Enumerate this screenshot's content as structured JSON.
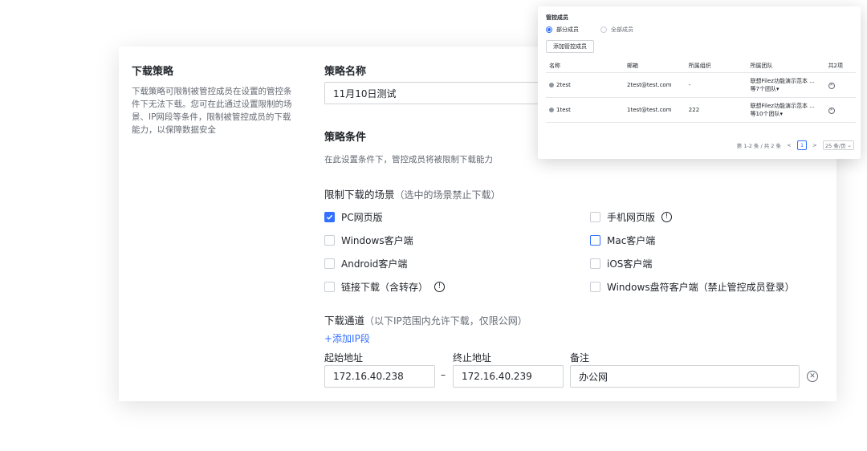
{
  "left": {
    "title": "下载策略",
    "desc": "下载策略可限制被管控成员在设置的管控条件下无法下载。您可在此通过设置限制的场景、IP网段等条件，限制被管控成员的下载能力，以保障数据安全"
  },
  "form": {
    "name_label": "策略名称",
    "name_value": "11月10日测试",
    "cond_label": "策略条件",
    "cond_hint": "在此设置条件下，管控成员将被限制下载能力",
    "scene_label": "限制下载的场景",
    "scene_sub": "（选中的场景禁止下载）",
    "options": [
      {
        "label": "PC网页版",
        "checked": true
      },
      {
        "label": "手机网页版",
        "checked": false,
        "info": true
      },
      {
        "label": "Windows客户端",
        "checked": false
      },
      {
        "label": "Mac客户端",
        "checked": false
      },
      {
        "label": "Android客户端",
        "checked": false
      },
      {
        "label": "iOS客户端",
        "checked": false
      },
      {
        "label": "链接下载（含转存）",
        "checked": false,
        "info": true
      },
      {
        "label": "Windows盘符客户端（禁止管控成员登录）",
        "checked": false
      }
    ],
    "channel_label": "下载通道",
    "channel_sub": "（以下IP范围内允许下载，仅限公网）",
    "add_ip": "+添加IP段",
    "start_label": "起始地址",
    "end_label": "终止地址",
    "note_label": "备注",
    "start_value": "172.16.40.238",
    "dash": "–",
    "end_value": "172.16.40.239",
    "note_value": "办公网"
  },
  "popup": {
    "title": "管控成员",
    "radio_partial": "部分成员",
    "radio_all": "全部成员",
    "add_btn": "添加管控成员",
    "headers": [
      "名称",
      "邮箱",
      "所属组织",
      "所属团队",
      "共2项"
    ],
    "rows": [
      {
        "name": "2test",
        "email": "2test@test.com",
        "org": "-",
        "team1": "联想Filez功能演示范本 ...",
        "team2": "等7个团队"
      },
      {
        "name": "1test",
        "email": "1test@test.com",
        "org": "222",
        "team1": "联想Filez功能演示范本 ...",
        "team2": "等10个团队"
      }
    ],
    "pager_text": "第 1-2 条 / 共 2 条",
    "page_prev": "<",
    "page_num": "1",
    "page_next": ">",
    "page_size": "25 条/页"
  },
  "icons": {
    "info": "info-icon",
    "remove": "close-circle-icon",
    "user": "user-icon",
    "check": "check-icon"
  },
  "colors": {
    "accent": "#3370ff",
    "text": "#1f2329",
    "muted": "#646a73",
    "border": "#d0d3d6"
  }
}
